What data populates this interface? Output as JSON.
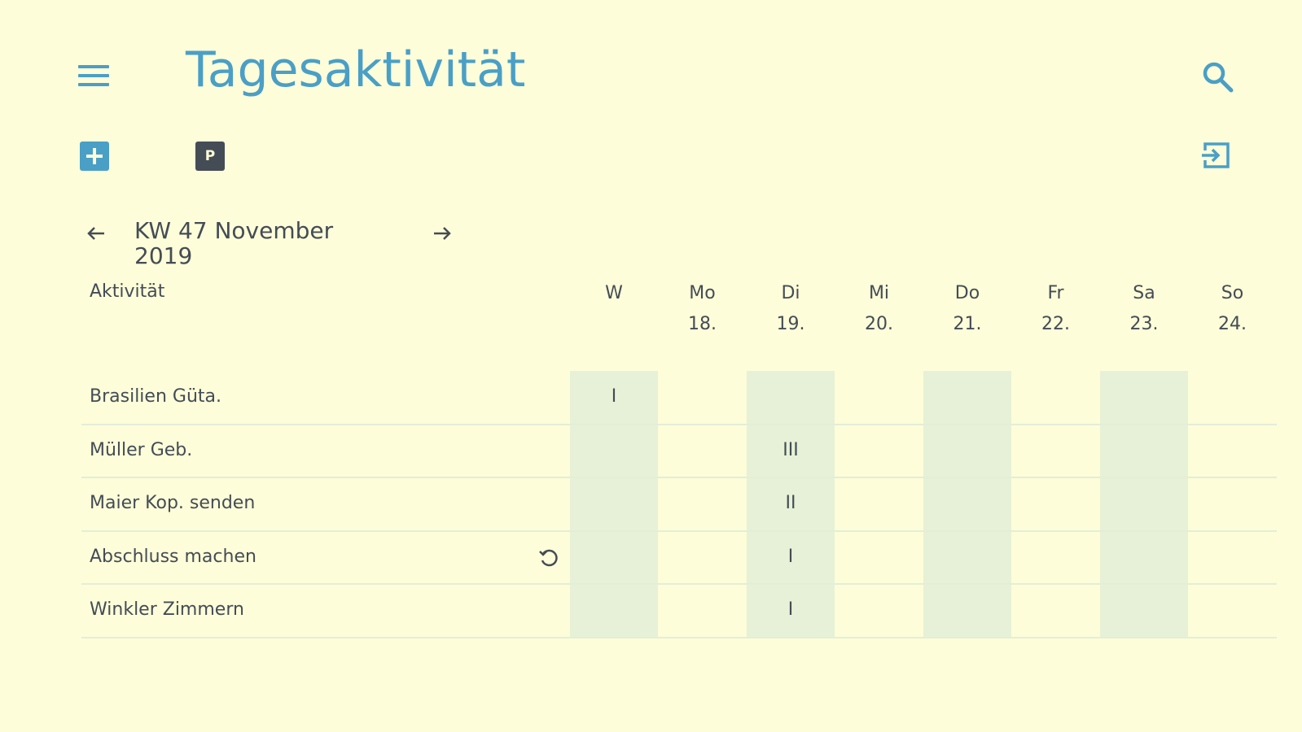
{
  "header": {
    "title": "Tagesaktivität",
    "menu_icon": "hamburger-menu-icon",
    "search_icon": "search-icon"
  },
  "toolbar": {
    "add_icon": "plus-square-icon",
    "p_label": "P",
    "logout_icon": "sign-in-icon"
  },
  "week_nav": {
    "label_line1": "KW 47 November",
    "label_line2": "2019",
    "prev_icon": "arrow-left-icon",
    "next_icon": "arrow-right-icon"
  },
  "table": {
    "activity_header": "Aktivität",
    "columns": [
      {
        "day": "W",
        "date": ""
      },
      {
        "day": "Mo",
        "date": "18."
      },
      {
        "day": "Di",
        "date": "19."
      },
      {
        "day": "Mi",
        "date": "20."
      },
      {
        "day": "Do",
        "date": "21."
      },
      {
        "day": "Fr",
        "date": "22."
      },
      {
        "day": "Sa",
        "date": "23."
      },
      {
        "day": "So",
        "date": "24."
      }
    ],
    "rows": [
      {
        "label": "Brasilien Güta.",
        "values": [
          "I",
          "",
          "",
          "",
          "",
          "",
          "",
          ""
        ],
        "repeat": false
      },
      {
        "label": "Müller Geb.",
        "values": [
          "",
          "",
          "III",
          "",
          "",
          "",
          "",
          ""
        ],
        "repeat": false
      },
      {
        "label": "Maier Kop. senden",
        "values": [
          "",
          "",
          "II",
          "",
          "",
          "",
          "",
          ""
        ],
        "repeat": false
      },
      {
        "label": "Abschluss machen",
        "values": [
          "",
          "",
          "I",
          "",
          "",
          "",
          "",
          ""
        ],
        "repeat": true
      },
      {
        "label": "Winkler Zimmern",
        "values": [
          "",
          "",
          "I",
          "",
          "",
          "",
          "",
          ""
        ],
        "repeat": false
      }
    ]
  },
  "colors": {
    "accent": "#4a9fc6",
    "text": "#444c55",
    "background": "#fdfdd9",
    "column_shade": "#e7f1d7"
  }
}
